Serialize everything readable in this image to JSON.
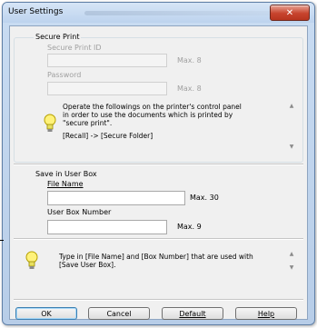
{
  "window": {
    "title": "User Settings",
    "close_glyph": "✕"
  },
  "secure_print": {
    "group_label": "Secure Print",
    "id_label": "Secure Print ID",
    "id_value": "",
    "id_max": "Max. 8",
    "password_label": "Password",
    "password_value": "",
    "password_max": "Max. 8",
    "info_line1": "Operate the followings on the printer's control panel",
    "info_line2": "in order to use the documents which is printed by",
    "info_line3": "\"secure print\".",
    "info_line4": "[Recall] -> [Secure Folder]"
  },
  "user_box": {
    "group_label": "Save in User Box",
    "file_name_label": "File Name",
    "file_name_value": "",
    "file_name_max": "Max. 30",
    "box_number_label": "User Box Number",
    "box_number_value": "",
    "box_number_max": "Max. 9"
  },
  "hint": {
    "line1": "Type in [File Name] and [Box Number] that are used with",
    "line2": "[Save User Box]."
  },
  "buttons": {
    "ok": "OK",
    "cancel": "Cancel",
    "default": "Default",
    "help": "Help"
  },
  "icons": {
    "info": "lightbulb-icon",
    "close": "close-icon"
  }
}
